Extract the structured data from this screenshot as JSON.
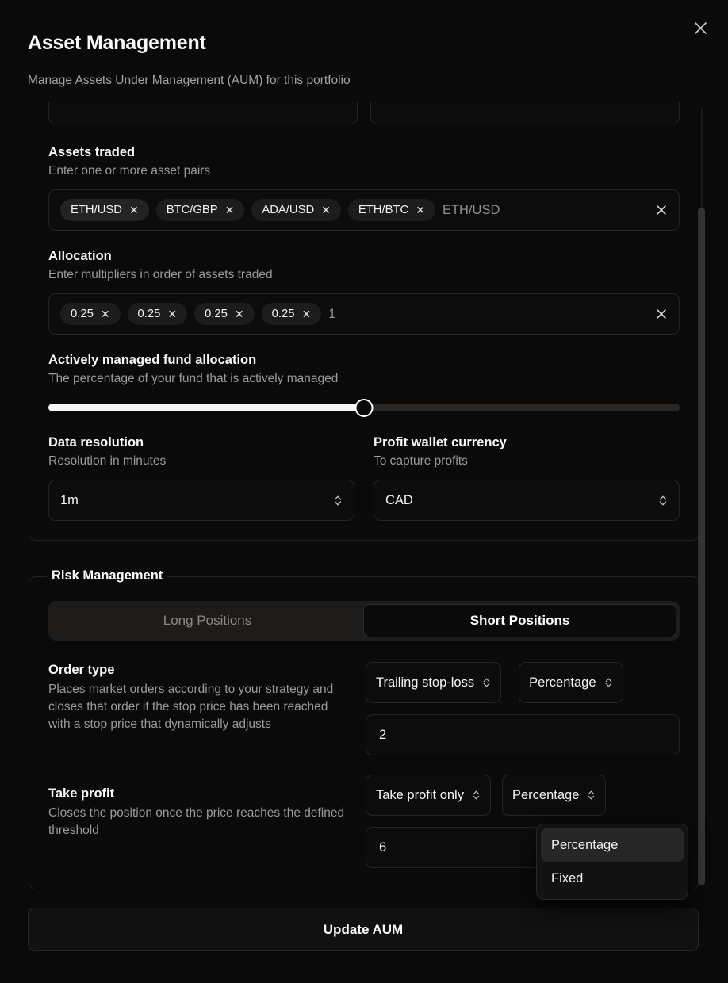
{
  "header": {
    "title": "Asset Management",
    "subtitle": "Manage Assets Under Management (AUM) for this portfolio",
    "close_icon": "close-icon"
  },
  "assets_traded": {
    "label": "Assets traded",
    "description": "Enter one or more asset pairs",
    "chips": [
      "ETH/USD",
      "BTC/GBP",
      "ADA/USD",
      "ETH/BTC"
    ],
    "placeholder": "ETH/USD",
    "chip_remove_glyph": "✕",
    "clear_glyph": "✕"
  },
  "allocation": {
    "label": "Allocation",
    "description": "Enter multipliers in order of assets traded",
    "chips": [
      "0.25",
      "0.25",
      "0.25",
      "0.25"
    ],
    "placeholder": "1",
    "chip_remove_glyph": "✕",
    "clear_glyph": "✕"
  },
  "active_fund": {
    "label": "Actively managed fund allocation",
    "description": "The percentage of your fund that is actively managed",
    "value_percent": 50,
    "fill_color": "#f7f7f5",
    "track_color": "#2b2724"
  },
  "data_resolution": {
    "label": "Data resolution",
    "description": "Resolution in minutes",
    "value": "1m"
  },
  "profit_wallet": {
    "label": "Profit wallet currency",
    "description": "To capture profits",
    "value": "CAD"
  },
  "risk_management": {
    "legend": "Risk Management",
    "tabs": [
      {
        "label": "Long Positions",
        "active": false
      },
      {
        "label": "Short Positions",
        "active": true
      }
    ],
    "order_type": {
      "label": "Order type",
      "description": "Places market orders according to your strategy and closes that order if the stop price has been reached with a stop price that dynamically adjusts",
      "type_select": "Trailing stop-loss",
      "unit_select": "Percentage",
      "amount": "2"
    },
    "take_profit": {
      "label": "Take profit",
      "description": "Closes the position once the price reaches the defined threshold",
      "type_select": "Take profit only",
      "unit_select": "Percentage",
      "amount": "6"
    },
    "open_dropdown": {
      "items": [
        {
          "label": "Percentage",
          "highlighted": true
        },
        {
          "label": "Fixed",
          "highlighted": false
        }
      ]
    }
  },
  "footer": {
    "update_label": "Update AUM"
  }
}
